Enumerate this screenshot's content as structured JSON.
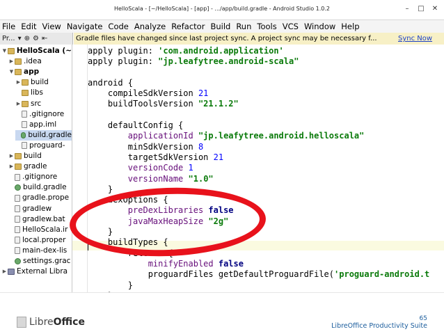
{
  "window": {
    "title": "HelloScala - [~/HelloScala] - [app] - .../app/build.gradle - Android Studio 1.0.2",
    "controls": [
      "minimize-icon",
      "maximize-icon",
      "close-icon"
    ]
  },
  "menu": [
    "File",
    "Edit",
    "View",
    "Navigate",
    "Code",
    "Analyze",
    "Refactor",
    "Build",
    "Run",
    "Tools",
    "VCS",
    "Window",
    "Help"
  ],
  "toolbar": {
    "project_tab": "Pr..."
  },
  "notification": {
    "message": "Gradle files have changed since last project sync. A project sync may be necessary f...",
    "action": "Sync Now"
  },
  "tree": [
    {
      "label": "HelloScala (~",
      "type": "folder",
      "depth": 0,
      "expanded": true,
      "bold": true
    },
    {
      "label": ".idea",
      "type": "folder",
      "depth": 1,
      "expanded": false
    },
    {
      "label": "app",
      "type": "folder",
      "depth": 1,
      "expanded": true,
      "bold": true
    },
    {
      "label": "build",
      "type": "folder",
      "depth": 2,
      "expanded": false
    },
    {
      "label": "libs",
      "type": "folder",
      "depth": 2,
      "expanded": null
    },
    {
      "label": "src",
      "type": "folder",
      "depth": 2,
      "expanded": false
    },
    {
      "label": ".gitignore",
      "type": "file",
      "depth": 2,
      "expanded": null
    },
    {
      "label": "app.iml",
      "type": "file",
      "depth": 2,
      "expanded": null
    },
    {
      "label": "build.gradle",
      "type": "gradle",
      "depth": 2,
      "expanded": null,
      "selected": true
    },
    {
      "label": "proguard-",
      "type": "file",
      "depth": 2,
      "expanded": null
    },
    {
      "label": "build",
      "type": "folder",
      "depth": 1,
      "expanded": false
    },
    {
      "label": "gradle",
      "type": "folder",
      "depth": 1,
      "expanded": false
    },
    {
      "label": ".gitignore",
      "type": "file",
      "depth": 1,
      "expanded": null
    },
    {
      "label": "build.gradle",
      "type": "gradle",
      "depth": 1,
      "expanded": null
    },
    {
      "label": "gradle.prope",
      "type": "file",
      "depth": 1,
      "expanded": null
    },
    {
      "label": "gradlew",
      "type": "file",
      "depth": 1,
      "expanded": null
    },
    {
      "label": "gradlew.bat",
      "type": "file",
      "depth": 1,
      "expanded": null
    },
    {
      "label": "HelloScala.ir",
      "type": "file",
      "depth": 1,
      "expanded": null
    },
    {
      "label": "local.proper",
      "type": "file",
      "depth": 1,
      "expanded": null
    },
    {
      "label": "main-dex-lis",
      "type": "file",
      "depth": 1,
      "expanded": null
    },
    {
      "label": "settings.grac",
      "type": "gradle",
      "depth": 1,
      "expanded": null
    },
    {
      "label": "External Libra",
      "type": "ext",
      "depth": 0,
      "expanded": false
    }
  ],
  "code": [
    [
      {
        "t": "apply plugin: "
      },
      {
        "t": "'com.android.application'",
        "c": "str"
      }
    ],
    [
      {
        "t": "apply plugin: "
      },
      {
        "t": "\"jp.leafytree.android-scala\"",
        "c": "str"
      }
    ],
    [
      {
        "t": ""
      }
    ],
    [
      {
        "t": "android {"
      }
    ],
    [
      {
        "t": "    compileSdkVersion "
      },
      {
        "t": "21",
        "c": "num"
      }
    ],
    [
      {
        "t": "    buildToolsVersion "
      },
      {
        "t": "\"21.1.2\"",
        "c": "str"
      }
    ],
    [
      {
        "t": ""
      }
    ],
    [
      {
        "t": "    defaultConfig {"
      }
    ],
    [
      {
        "t": "        "
      },
      {
        "t": "applicationId",
        "c": "prop"
      },
      {
        "t": " "
      },
      {
        "t": "\"jp.leafytree.android.helloscala\"",
        "c": "str"
      }
    ],
    [
      {
        "t": "        minSdkVersion "
      },
      {
        "t": "8",
        "c": "num"
      }
    ],
    [
      {
        "t": "        targetSdkVersion "
      },
      {
        "t": "21",
        "c": "num"
      }
    ],
    [
      {
        "t": "        "
      },
      {
        "t": "versionCode",
        "c": "prop"
      },
      {
        "t": " "
      },
      {
        "t": "1",
        "c": "num"
      }
    ],
    [
      {
        "t": "        "
      },
      {
        "t": "versionName",
        "c": "prop"
      },
      {
        "t": " "
      },
      {
        "t": "\"1.0\"",
        "c": "str"
      }
    ],
    [
      {
        "t": "    }"
      }
    ],
    [
      {
        "t": "    dexOptions {"
      }
    ],
    [
      {
        "t": "        "
      },
      {
        "t": "preDexLibraries",
        "c": "prop"
      },
      {
        "t": " "
      },
      {
        "t": "false",
        "c": "kw"
      }
    ],
    [
      {
        "t": "        "
      },
      {
        "t": "javaMaxHeapSize",
        "c": "prop"
      },
      {
        "t": " "
      },
      {
        "t": "\"2g\"",
        "c": "str"
      }
    ],
    [
      {
        "t": "    }"
      }
    ],
    [
      {
        "t": "    buildTypes {"
      }
    ],
    [
      {
        "t": "        release {"
      }
    ],
    [
      {
        "t": "            "
      },
      {
        "t": "minifyEnabled",
        "c": "prop"
      },
      {
        "t": " "
      },
      {
        "t": "false",
        "c": "kw"
      }
    ],
    [
      {
        "t": "            proguardFiles getDefaultProguardFile("
      },
      {
        "t": "'proguard-android.t",
        "c": "str"
      }
    ],
    [
      {
        "t": "        }"
      }
    ],
    [
      {
        "t": "    }"
      }
    ]
  ],
  "annotation": {
    "color": "#e8121b"
  },
  "footer": {
    "logo_light": "Libre",
    "logo_bold": "Office",
    "page_number": "65",
    "suite": "LibreOffice Productivity Suite"
  }
}
